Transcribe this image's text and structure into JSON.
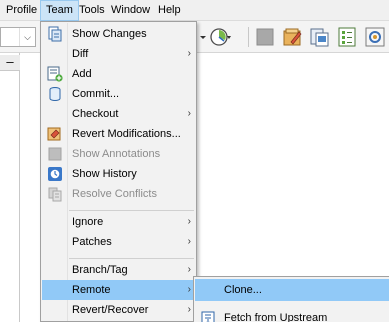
{
  "menubar": {
    "items": [
      {
        "label": "Profile"
      },
      {
        "label": "Team"
      },
      {
        "label": "Tools"
      },
      {
        "label": "Window"
      },
      {
        "label": "Help"
      }
    ],
    "active": "Team"
  },
  "toolbar": {
    "combo_arrow": "⌵"
  },
  "left_panel": {
    "minus": "–"
  },
  "team_menu": {
    "items": [
      {
        "label": "Show Changes",
        "icon": "show-changes-icon",
        "enabled": true
      },
      {
        "label": "Diff",
        "submenu": true,
        "enabled": true
      },
      {
        "label": "Add",
        "icon": "add-icon",
        "enabled": true
      },
      {
        "label": "Commit...",
        "icon": "commit-icon",
        "enabled": true
      },
      {
        "label": "Checkout",
        "submenu": true,
        "enabled": true
      },
      {
        "label": "Revert Modifications...",
        "icon": "revert-icon",
        "enabled": true
      },
      {
        "label": "Show Annotations",
        "icon": "annotations-icon",
        "enabled": false
      },
      {
        "label": "Show History",
        "icon": "history-icon",
        "enabled": true
      },
      {
        "label": "Resolve Conflicts",
        "icon": "resolve-conflicts-icon",
        "enabled": false
      },
      {
        "label": "Ignore",
        "submenu": true,
        "enabled": true
      },
      {
        "label": "Patches",
        "submenu": true,
        "enabled": true
      },
      {
        "label": "Branch/Tag",
        "submenu": true,
        "enabled": true
      },
      {
        "label": "Remote",
        "submenu": true,
        "enabled": true,
        "highlighted": true
      },
      {
        "label": "Revert/Recover",
        "submenu": true,
        "enabled": true
      }
    ],
    "submenu_arrow": "›"
  },
  "remote_submenu": {
    "items": [
      {
        "label": "Clone...",
        "highlighted": true
      },
      {
        "label": "Fetch from Upstream",
        "icon": "fetch-icon"
      }
    ]
  },
  "colors": {
    "highlight": "#91c9f7",
    "menu_bg": "#f2f2f2",
    "disabled_text": "#8c8c8c"
  }
}
